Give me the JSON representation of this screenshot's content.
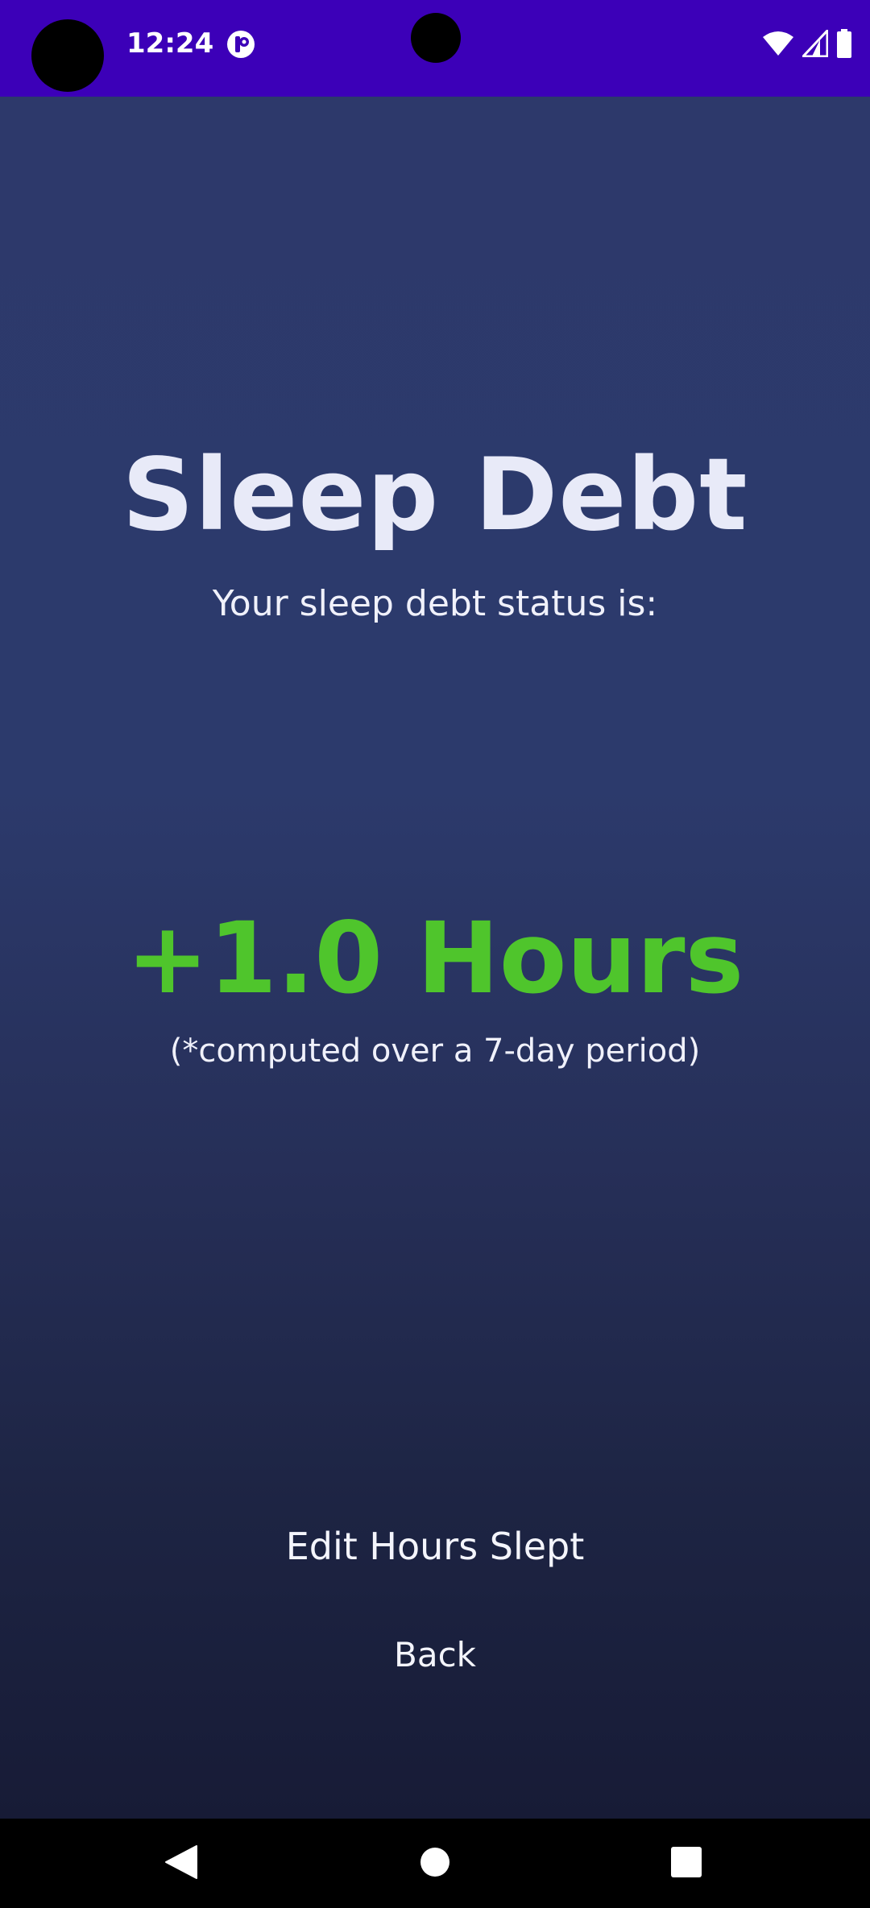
{
  "status_bar": {
    "time": "12:24",
    "background_color": "#3c00b8",
    "icons": [
      "notification-app-icon",
      "wifi-icon",
      "signal-icon",
      "battery-icon"
    ]
  },
  "main": {
    "title": "Sleep Debt",
    "subtitle": "Your sleep debt status is:",
    "debt_value": "+1.0 Hours",
    "debt_value_color": "#4fc52c",
    "footnote": "(*computed over a 7-day period)"
  },
  "actions": {
    "edit_label": "Edit Hours Slept",
    "back_label": "Back"
  },
  "nav_bar": {
    "icons": [
      "nav-back-icon",
      "nav-home-icon",
      "nav-recents-icon"
    ]
  }
}
